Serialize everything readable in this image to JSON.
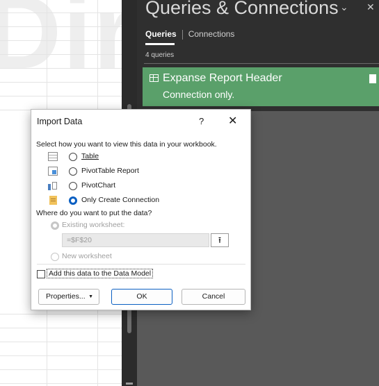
{
  "background": {
    "watermark": "Diriem"
  },
  "pane": {
    "title": "Queries & Connections",
    "tabs": [
      "Queries",
      "Connections"
    ],
    "count": "4 queries",
    "query": {
      "name": "Expanse Report Header",
      "status": "Connection only."
    },
    "colors": {
      "header": "#2f2f2f",
      "body": "#595959",
      "card": "#5aa06a"
    }
  },
  "dialog": {
    "title": "Import Data",
    "help": "?",
    "close": "✕",
    "view_prompt": "Select how you want to view this data in your workbook.",
    "view_options": [
      {
        "label": "Table",
        "icon": "table-icon",
        "checked": false
      },
      {
        "label": "PivotTable Report",
        "icon": "pivot-table-icon",
        "checked": false
      },
      {
        "label": "PivotChart",
        "icon": "pivot-chart-icon",
        "checked": false
      },
      {
        "label": "Only Create Connection",
        "icon": "connection-icon",
        "checked": true
      }
    ],
    "location_prompt": "Where do you want to put the data?",
    "existing_label": "Existing worksheet:",
    "range_value": "=$F$20",
    "new_label": "New worksheet",
    "data_model_label": "Add this data to the Data Model",
    "properties_label": "Properties...",
    "ok_label": "OK",
    "cancel_label": "Cancel",
    "accent": "#0a5fc2"
  }
}
